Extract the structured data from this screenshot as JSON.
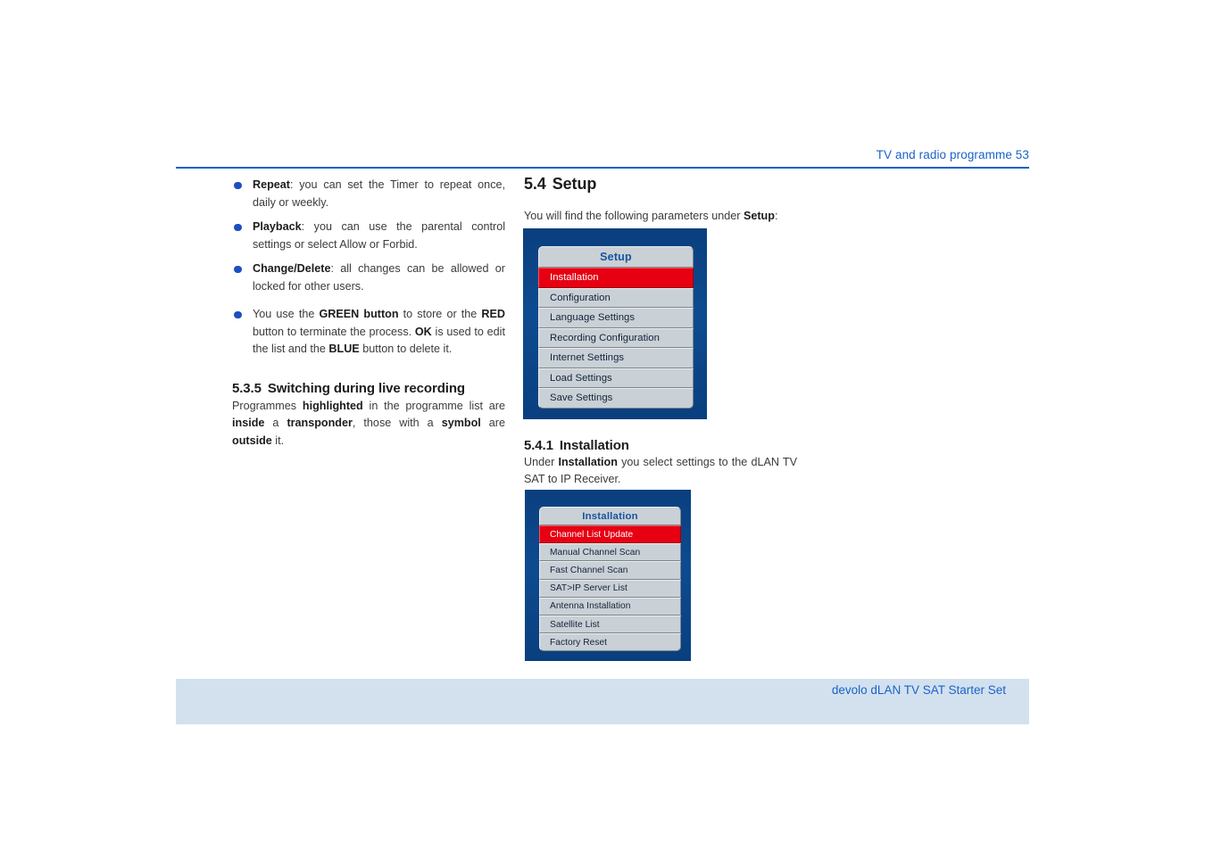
{
  "header": {
    "title": "TV and radio programme 53"
  },
  "footer": {
    "text": "devolo dLAN TV SAT Starter Set"
  },
  "left_column": {
    "bullets": [
      {
        "lead": "Repeat",
        "rest": ": you can set the Timer to repeat once, daily or weekly."
      },
      {
        "lead": "Playback",
        "rest": ": you can use the parental control settings or select Allow or Forbid."
      },
      {
        "lead": "Change/Delete",
        "rest": ": all changes can be allowed or locked for other users."
      },
      {
        "lead": "",
        "rest": "You use the GREEN button to store or the RED button to terminate the process. OK is used to edit the list and the BLUE button to delete it."
      }
    ],
    "section_535": {
      "number": "5.3.5",
      "title": "Switching during live recording",
      "body": "Programmes highlighted in the programme list are inside a transponder, those with a symbol are outside it."
    }
  },
  "right_column": {
    "section_54": {
      "number": "5.4",
      "title": "Setup",
      "intro": "You will find the following parameters under Setup:"
    },
    "section_541": {
      "number": "5.4.1",
      "title": "Installation",
      "body": "Under Installation you select settings to the dLAN TV SAT to IP Receiver."
    }
  },
  "setup_menu": {
    "title": "Setup",
    "items": [
      {
        "label": "Installation",
        "selected": true
      },
      {
        "label": "Configuration",
        "selected": false
      },
      {
        "label": "Language Settings",
        "selected": false
      },
      {
        "label": "Recording Configuration",
        "selected": false
      },
      {
        "label": "Internet Settings",
        "selected": false
      },
      {
        "label": "Load Settings",
        "selected": false
      },
      {
        "label": "Save Settings",
        "selected": false
      }
    ]
  },
  "installation_menu": {
    "title": "Installation",
    "items": [
      {
        "label": "Channel List Update",
        "selected": true
      },
      {
        "label": "Manual Channel Scan",
        "selected": false
      },
      {
        "label": "Fast Channel Scan",
        "selected": false
      },
      {
        "label": "SAT>IP Server List",
        "selected": false
      },
      {
        "label": "Antenna Installation",
        "selected": false
      },
      {
        "label": "Satellite List",
        "selected": false
      },
      {
        "label": "Factory Reset",
        "selected": false
      }
    ]
  },
  "colors": {
    "accent_blue": "#1a62c9",
    "rule_blue": "#1161c9",
    "footer_band": "#d3e1ee",
    "menu_bg_blue": "#0d4b90",
    "menu_row_gray": "#c9d0d6",
    "menu_selected_red": "#e60012",
    "bullet_blue": "#1c4ec4"
  }
}
